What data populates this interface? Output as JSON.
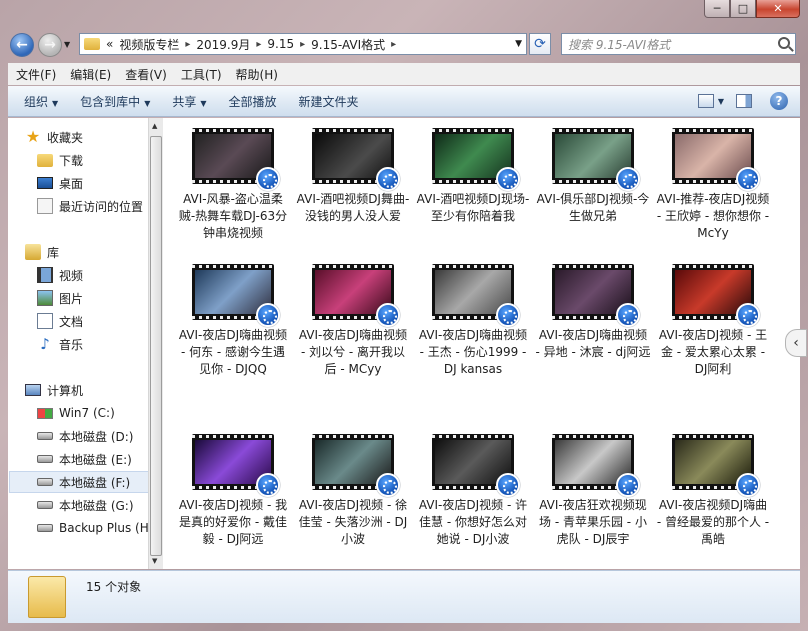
{
  "window": {
    "min": "─",
    "max": "□",
    "close": "✕"
  },
  "address": {
    "crumbs": [
      "视频版专栏",
      "2019.9月",
      "9.15",
      "9.15-AVI格式"
    ],
    "prefix": "«"
  },
  "search": {
    "placeholder": "搜索 9.15-AVI格式"
  },
  "menu": [
    "文件(F)",
    "编辑(E)",
    "查看(V)",
    "工具(T)",
    "帮助(H)"
  ],
  "commands": {
    "organize": "组织",
    "include": "包含到库中",
    "share": "共享",
    "playall": "全部播放",
    "newfolder": "新建文件夹"
  },
  "nav": {
    "favorites": "收藏夹",
    "downloads": "下载",
    "desktop": "桌面",
    "recent": "最近访问的位置",
    "libraries": "库",
    "videos": "视频",
    "pictures": "图片",
    "documents": "文档",
    "music": "音乐",
    "computer": "计算机",
    "win7": "Win7 (C:)",
    "diskD": "本地磁盘 (D:)",
    "diskE": "本地磁盘 (E:)",
    "diskF": "本地磁盘 (F:)",
    "diskG": "本地磁盘 (G:)",
    "backup": "Backup Plus (H:"
  },
  "files": [
    {
      "name": "AVI-风暴-盗心温柔贼-热舞车载DJ-63分钟串烧视频"
    },
    {
      "name": "AVI-酒吧视频DJ舞曲-没钱的男人没人爱"
    },
    {
      "name": "AVI-酒吧视频DJ现场-至少有你陪着我"
    },
    {
      "name": "AVI-俱乐部DJ视频-今生做兄弟"
    },
    {
      "name": "AVI-推荐-夜店DJ视频 - 王欣婷 - 想你想你 - McYy"
    },
    {
      "name": "AVI-夜店DJ嗨曲视频 - 何东 - 感谢今生遇见你 - DJQQ"
    },
    {
      "name": "AVI-夜店DJ嗨曲视频 - 刘以兮 - 离开我以后 - MCyy"
    },
    {
      "name": "AVI-夜店DJ嗨曲视频 - 王杰 - 伤心1999 - DJ kansas"
    },
    {
      "name": "AVI-夜店DJ嗨曲视频 - 异地 - 沐宸 - dj阿远"
    },
    {
      "name": "AVI-夜店DJ视频 - 王金 - 爱太累心太累 - DJ阿利"
    },
    {
      "name": "AVI-夜店DJ视频 - 我是真的好爱你 - 戴佳毅 - DJ阿远"
    },
    {
      "name": "AVI-夜店DJ视频 - 徐佳莹 - 失落沙洲 - DJ小波"
    },
    {
      "name": "AVI-夜店DJ视频 - 许佳慧 - 你想好怎么对她说 - DJ小波"
    },
    {
      "name": "AVI-夜店狂欢视频现场 - 青苹果乐园 - 小虎队 - DJ辰宇"
    },
    {
      "name": "AVI-夜店视频DJ嗨曲 - 曾经最爱的那个人 - 禹皓"
    }
  ],
  "status": {
    "count": "15 个对象"
  }
}
